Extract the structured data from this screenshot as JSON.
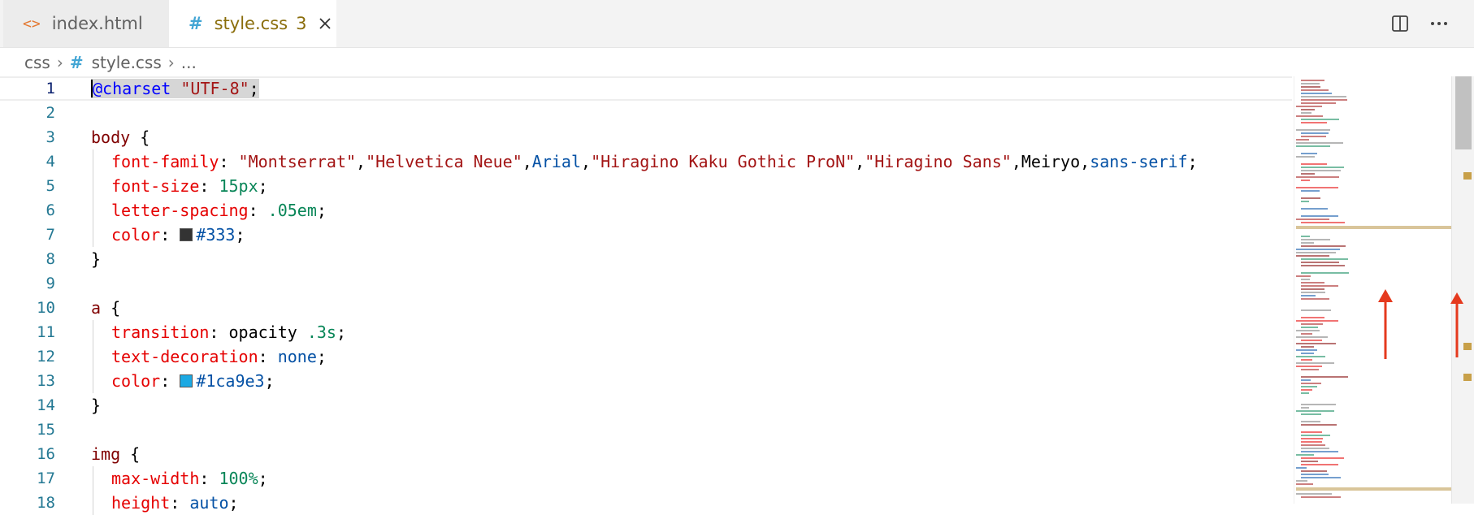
{
  "tabs": [
    {
      "label": "index.html",
      "icon": "html-file-icon",
      "active": false
    },
    {
      "label": "style.css",
      "icon": "css-file-icon",
      "active": true,
      "problems": "3"
    }
  ],
  "breadcrumb": {
    "folder": "css",
    "file": "style.css",
    "more": "..."
  },
  "editor": {
    "line_numbers": [
      "1",
      "2",
      "3",
      "4",
      "5",
      "6",
      "7",
      "8",
      "9",
      "10",
      "11",
      "12",
      "13",
      "14",
      "15",
      "16",
      "17",
      "18"
    ],
    "lines": {
      "l1": {
        "at": "@charset",
        "str": "\"UTF-8\"",
        "end": ";"
      },
      "l3": {
        "sel": "body",
        "open": " {"
      },
      "l4": {
        "prop": "font-family",
        "colon": ": ",
        "s1": "\"Montserrat\"",
        "c1": ",",
        "s2": "\"Helvetica Neue\"",
        "c2": ",",
        "v1": "Arial",
        "c3": ",",
        "s3": "\"Hiragino Kaku Gothic ProN\"",
        "c4": ",",
        "s4": "\"Hiragino Sans\"",
        "c5": ",",
        "t1": "Meiryo",
        "c6": ",",
        "v2": "sans-serif",
        "end": ";"
      },
      "l5": {
        "prop": "font-size",
        "colon": ": ",
        "num": "15px",
        "end": ";"
      },
      "l6": {
        "prop": "letter-spacing",
        "colon": ": ",
        "num": ".05em",
        "end": ";"
      },
      "l7": {
        "prop": "color",
        "colon": ": ",
        "val": "#333",
        "end": ";"
      },
      "l8": {
        "close": "}"
      },
      "l10": {
        "sel": "a",
        "open": " {"
      },
      "l11": {
        "prop": "transition",
        "colon": ": ",
        "t1": "opacity ",
        "num": ".3s",
        "end": ";"
      },
      "l12": {
        "prop": "text-decoration",
        "colon": ": ",
        "val": "none",
        "end": ";"
      },
      "l13": {
        "prop": "color",
        "colon": ": ",
        "val": "#1ca9e3",
        "end": ";"
      },
      "l14": {
        "close": "}"
      },
      "l16": {
        "sel": "img",
        "open": " {"
      },
      "l17": {
        "prop": "max-width",
        "colon": ": ",
        "num": "100%",
        "end": ";"
      },
      "l18": {
        "prop": "height",
        "colon": ": ",
        "val": "auto",
        "end": ";"
      }
    },
    "swatches": {
      "c333": "#333333",
      "c1ca9e3": "#1ca9e3"
    }
  },
  "colors": {
    "accent_arrow": "#e53a1e",
    "tab_modified": "#8a6d0b"
  }
}
